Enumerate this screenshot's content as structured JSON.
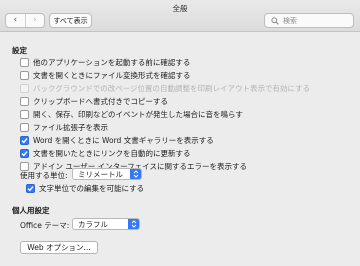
{
  "window": {
    "title": "全般"
  },
  "toolbar": {
    "back_label": "‹",
    "forward_label": "›",
    "show_all_label": "すべて表示",
    "search_placeholder": "検索"
  },
  "settings": {
    "heading": "設定",
    "options": [
      {
        "label": "他のアプリケーションを起動する前に確認する",
        "checked": false,
        "disabled": false
      },
      {
        "label": "文書を開くときにファイル変換形式を確認する",
        "checked": false,
        "disabled": false
      },
      {
        "label": "バックグラウンドでの改ページ位置の自動調整を印刷レイアウト表示で有効にする",
        "checked": false,
        "disabled": true
      },
      {
        "label": "クリップボードへ書式付きでコピーする",
        "checked": false,
        "disabled": false
      },
      {
        "label": "開く、保存、印刷などのイベントが発生した場合に音を鳴らす",
        "checked": false,
        "disabled": false
      },
      {
        "label": "ファイル拡張子を表示",
        "checked": false,
        "disabled": false
      },
      {
        "label": "Word を開くときに Word 文書ギャラリーを表示する",
        "checked": true,
        "disabled": false
      },
      {
        "label": "文書を開いたときにリンクを自動的に更新する",
        "checked": true,
        "disabled": false
      },
      {
        "label": "アドイン ユーザー インターフェイスに関するエラーを表示する",
        "checked": false,
        "disabled": false
      }
    ],
    "unit_label": "使用する単位:",
    "unit_value": "ミリメートル",
    "char_unit_label": "文字単位での編集を可能にする",
    "char_unit_checked": true
  },
  "personal": {
    "heading": "個人用設定",
    "theme_label": "Office テーマ:",
    "theme_value": "カラフル",
    "web_options_label": "Web オプション..."
  },
  "colors": {
    "accent": "#3478f6",
    "background": "#ececec",
    "disabled_text": "#b3b3b3"
  }
}
